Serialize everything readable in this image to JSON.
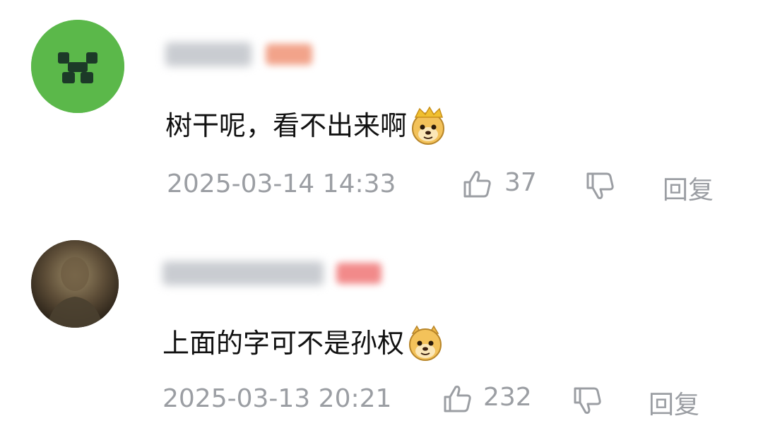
{
  "comments": [
    {
      "text": "树干呢，看不出来啊",
      "emoji_icon": "doge-crown-emoji",
      "timestamp": "2025-03-14 14:33",
      "likes": "37",
      "reply_label": "回复",
      "avatar_color": "#5bb84a"
    },
    {
      "text": "上面的字可不是孙权",
      "emoji_icon": "doge-emoji",
      "timestamp": "2025-03-13 20:21",
      "likes": "232",
      "reply_label": "回复"
    }
  ],
  "colors": {
    "meta_text": "#9b9ea3",
    "badge_1": "#f2a38a",
    "badge_2": "#f28a8a"
  },
  "icons": [
    "thumbs-up-icon",
    "thumbs-down-icon"
  ]
}
